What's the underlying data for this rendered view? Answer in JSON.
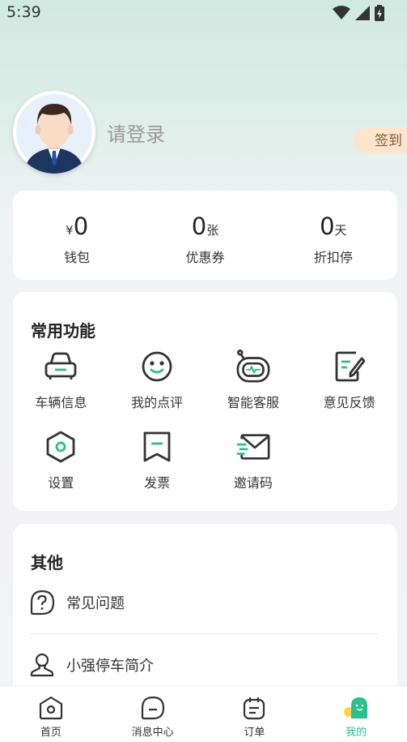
{
  "status_bar": {
    "time": "5:39"
  },
  "profile": {
    "login_text": "请登录",
    "checkin_label": "签到"
  },
  "stats": [
    {
      "prefix": "¥",
      "value": "0",
      "unit": "",
      "label": "钱包"
    },
    {
      "prefix": "",
      "value": "0",
      "unit": "张",
      "label": "优惠券"
    },
    {
      "prefix": "",
      "value": "0",
      "unit": "天",
      "label": "折扣停"
    }
  ],
  "functions": {
    "title": "常用功能",
    "items": [
      {
        "label": "车辆信息",
        "icon": "car-icon"
      },
      {
        "label": "我的点评",
        "icon": "smiley-icon"
      },
      {
        "label": "智能客服",
        "icon": "robot-icon"
      },
      {
        "label": "意见反馈",
        "icon": "feedback-icon"
      },
      {
        "label": "设置",
        "icon": "settings-icon"
      },
      {
        "label": "发票",
        "icon": "invoice-icon"
      },
      {
        "label": "邀请码",
        "icon": "mail-icon"
      }
    ]
  },
  "other": {
    "title": "其他",
    "items": [
      {
        "label": "常见问题",
        "icon": "question-icon"
      },
      {
        "label": "小强停车简介",
        "icon": "person-icon"
      }
    ]
  },
  "bottom_nav": {
    "items": [
      {
        "label": "首页",
        "icon": "home-icon"
      },
      {
        "label": "消息中心",
        "icon": "message-icon"
      },
      {
        "label": "订单",
        "icon": "order-icon"
      },
      {
        "label": "我的",
        "icon": "mine-icon",
        "active": true
      }
    ]
  },
  "colors": {
    "accent": "#2dbf8f",
    "checkin_bg": "#fde4cc",
    "icon_stroke": "#333333"
  }
}
